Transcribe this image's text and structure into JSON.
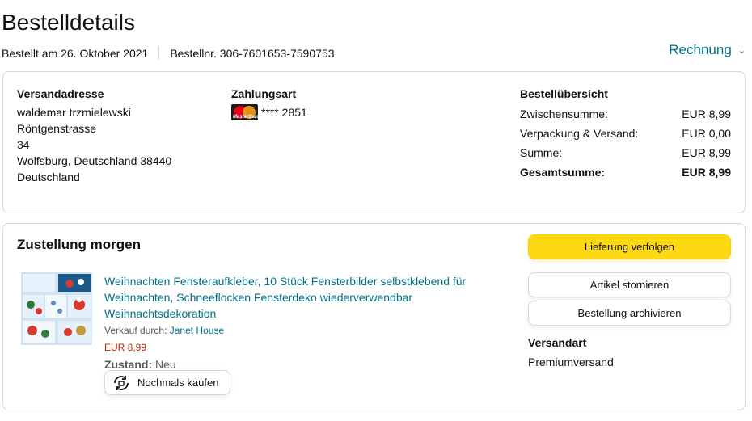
{
  "header": {
    "title": "Bestelldetails",
    "ordered_on": "Bestellt am 26. Oktober 2021",
    "order_number": "Bestellnr. 306-7601653-7590753",
    "invoice_label": "Rechnung"
  },
  "shipping": {
    "heading": "Versandadresse",
    "lines": [
      "waldemar trzmielewski",
      "Röntgenstrasse",
      "34",
      "Wolfsburg, Deutschland 38440",
      "Deutschland"
    ]
  },
  "payment": {
    "heading": "Zahlungsart",
    "card_number": "**** 2851",
    "card_logo_text": "MasterCard",
    "card_colors": {
      "red": "#eb001b",
      "orange": "#f79e1b"
    }
  },
  "summary": {
    "heading": "Bestellübersicht",
    "rows": [
      {
        "label": "Zwischensumme:",
        "value": "EUR 8,99"
      },
      {
        "label": "Verpackung & Versand:",
        "value": "EUR 0,00"
      },
      {
        "label": "Summe:",
        "value": "EUR 8,99"
      },
      {
        "label": "Gesamtsumme:",
        "value": "EUR 8,99"
      }
    ]
  },
  "delivery": {
    "status": "Zustellung morgen",
    "item": {
      "title": "Weihnachten Fensteraufkleber, 10 Stück Fensterbilder selbstklebend für Weihnachten, Schneeflocken Fensterdeko wiederverwendbar Weihnachtsdekoration",
      "seller_prefix": "Verkauf durch:",
      "seller_name": "Janet House",
      "price": "EUR 8,99",
      "condition_label": "Zustand:",
      "condition_value": "Neu",
      "buy_again_label": "Nochmals kaufen",
      "buy_again_icon": "rebuy-icon"
    },
    "actions": {
      "track": "Lieferung verfolgen",
      "cancel": "Artikel stornieren",
      "archive": "Bestellung archivieren"
    },
    "shipping_type_heading": "Versandart",
    "shipping_type_value": "Premiumversand"
  },
  "colors": {
    "link": "#007185",
    "price": "#b12704",
    "primary_button": "#ffd814",
    "border": "#d5d9d9"
  }
}
